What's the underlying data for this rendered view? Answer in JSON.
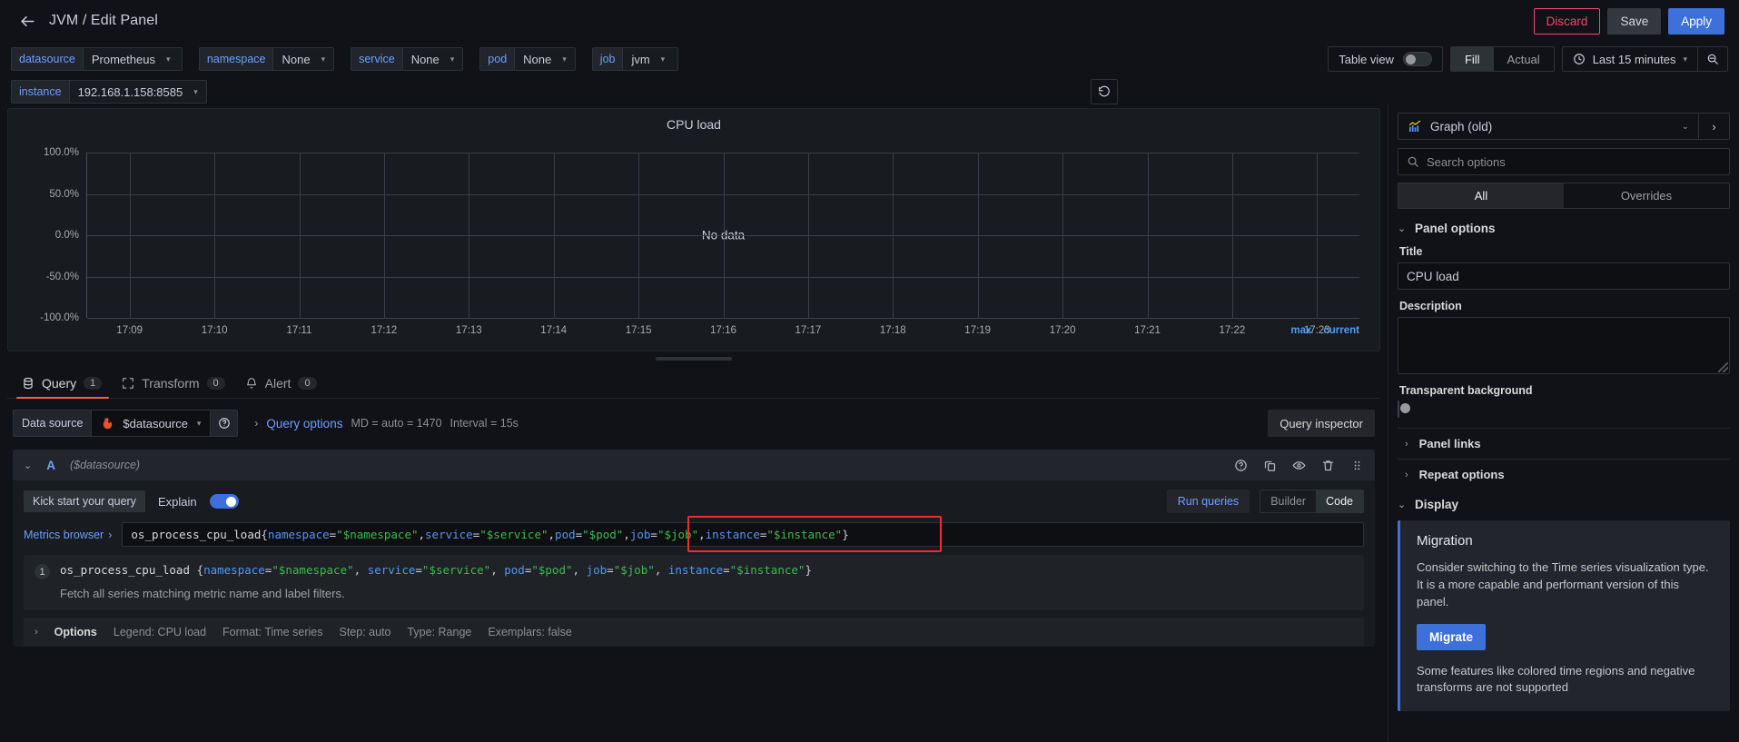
{
  "topbar": {
    "back_icon": "arrow-left-icon",
    "breadcrumb": "JVM / Edit Panel",
    "discard_label": "Discard",
    "save_label": "Save",
    "apply_label": "Apply"
  },
  "variables": [
    {
      "label": "datasource",
      "value": "Prometheus",
      "name": "datasource"
    },
    {
      "label": "namespace",
      "value": "None",
      "name": "namespace"
    },
    {
      "label": "service",
      "value": "None",
      "name": "service"
    },
    {
      "label": "pod",
      "value": "None",
      "name": "pod"
    },
    {
      "label": "job",
      "value": "jvm",
      "name": "job"
    },
    {
      "label": "instance",
      "value": "192.168.1.158:8585",
      "name": "instance"
    }
  ],
  "toolbar": {
    "table_view_label": "Table view",
    "table_view_on": false,
    "fill_label": "Fill",
    "actual_label": "Actual",
    "fill_active": true,
    "time_range": "Last 15 minutes",
    "clock_icon": "clock-icon",
    "zoom_out_icon": "zoom-out-icon",
    "refresh_icon": "refresh-icon"
  },
  "chart_data": {
    "type": "line",
    "title": "CPU load",
    "no_data_text": "No data",
    "xlabel": "",
    "ylabel": "",
    "ylim": [
      -100,
      100
    ],
    "ytick_labels": [
      "100.0%",
      "50.0%",
      "0.0%",
      "-50.0%",
      "-100.0%"
    ],
    "ytick_values": [
      100,
      50,
      0,
      -50,
      -100
    ],
    "xtick_labels": [
      "17:09",
      "17:10",
      "17:11",
      "17:12",
      "17:13",
      "17:14",
      "17:15",
      "17:16",
      "17:17",
      "17:18",
      "17:19",
      "17:20",
      "17:21",
      "17:22",
      "17:23"
    ],
    "series": [],
    "legend": {
      "position": "bottom-right",
      "entries": [
        "max",
        "current"
      ]
    },
    "grid": true
  },
  "tabs": [
    {
      "label": "Query",
      "count": "1",
      "icon": "database-icon",
      "active": true
    },
    {
      "label": "Transform",
      "count": "0",
      "icon": "transform-icon",
      "active": false
    },
    {
      "label": "Alert",
      "count": "0",
      "icon": "bell-icon",
      "active": false
    }
  ],
  "query_header": {
    "data_source_label": "Data source",
    "data_source_value": "$datasource",
    "help_icon": "help-circle-icon",
    "query_options_label": "Query options",
    "query_options_meta_md": "MD = auto = 1470",
    "query_options_meta_interval": "Interval = 15s",
    "query_inspector_label": "Query inspector"
  },
  "query": {
    "ref_id": "A",
    "datasource_note": "($datasource)",
    "header_icons": [
      "help-circle-icon",
      "copy-icon",
      "eye-icon",
      "trash-icon",
      "drag-handle-icon"
    ],
    "kick_start_label": "Kick start your query",
    "explain_label": "Explain",
    "explain_on": true,
    "run_queries_label": "Run queries",
    "builder_label": "Builder",
    "code_label": "Code",
    "mode_code_active": true,
    "metrics_browser_label": "Metrics browser",
    "expr_metric": "os_process_cpu_load",
    "expr_labels": [
      {
        "key": "namespace",
        "value": "\"$namespace\""
      },
      {
        "key": "service",
        "value": "\"$service\""
      },
      {
        "key": "pod",
        "value": "\"$pod\""
      },
      {
        "key": "job",
        "value": "\"$job\""
      },
      {
        "key": "instance",
        "value": "\"$instance\""
      }
    ],
    "explain_line_number": "1",
    "explain_description": "Fetch all series matching metric name and label filters.",
    "options_label": "Options",
    "options_items": [
      "Legend: CPU load",
      "Format: Time series",
      "Step: auto",
      "Type: Range",
      "Exemplars: false"
    ]
  },
  "sidebar": {
    "viz_name": "Graph (old)",
    "viz_icon": "graph-icon",
    "search_placeholder": "Search options",
    "search_value": "",
    "search_icon": "search-icon",
    "tab_all": "All",
    "tab_overrides": "Overrides",
    "panel_options_title": "Panel options",
    "title_label": "Title",
    "title_value": "CPU load",
    "description_label": "Description",
    "description_value": "",
    "transparent_label": "Transparent background",
    "transparent_on": false,
    "panel_links_label": "Panel links",
    "repeat_options_label": "Repeat options",
    "display_title": "Display",
    "migration_title": "Migration",
    "migration_text": "Consider switching to the Time series visualization type. It is a more capable and performant version of this panel.",
    "migrate_button": "Migrate",
    "migration_note": "Some features like colored time regions and negative transforms are not supported"
  },
  "colors": {
    "accent_blue": "#3d71d9",
    "link_blue": "#6e9fff",
    "danger_red": "#f5456c",
    "tab_orange": "#f55f3e",
    "annotation_red": "#f02d2d",
    "string_green": "#3fb950"
  }
}
